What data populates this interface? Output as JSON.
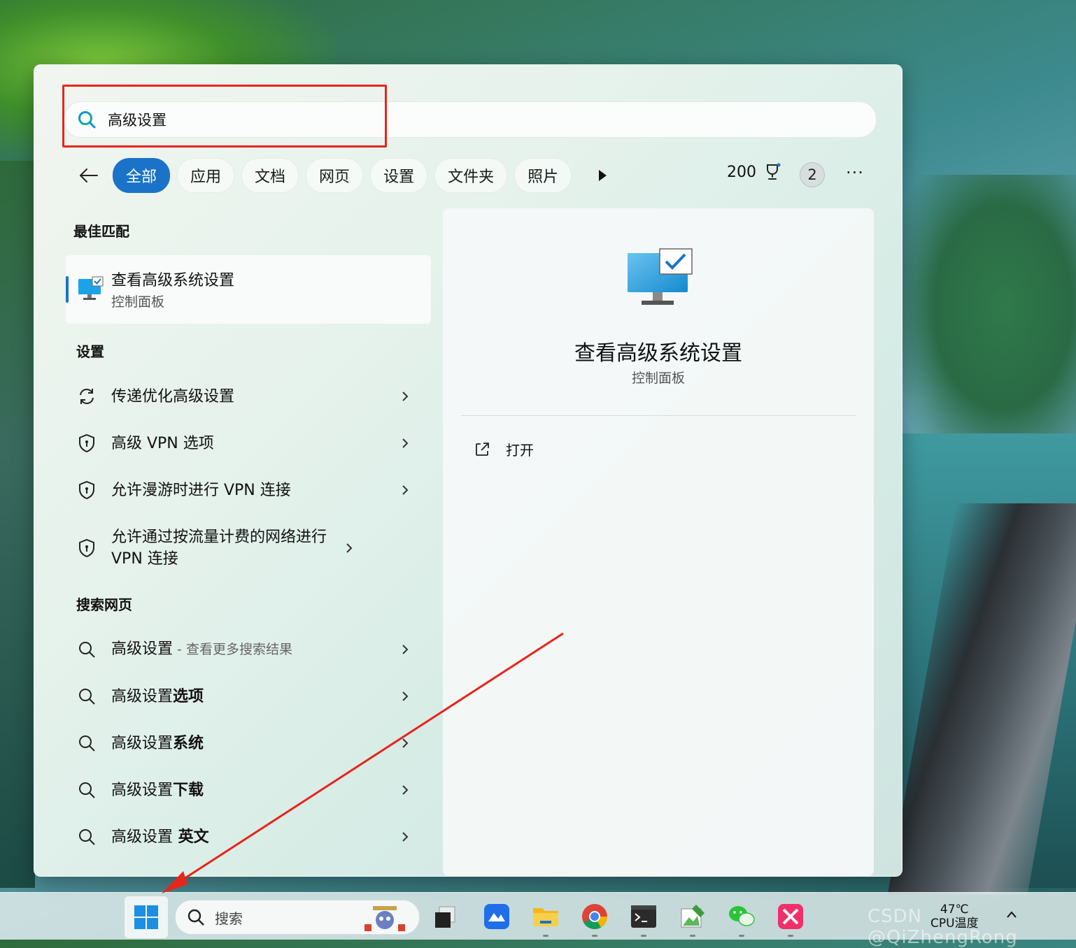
{
  "search": {
    "query": "高级设置"
  },
  "filters": {
    "chips": [
      "全部",
      "应用",
      "文档",
      "网页",
      "设置",
      "文件夹",
      "照片"
    ],
    "active_index": 0,
    "points": "200",
    "badge": "2",
    "more": "···"
  },
  "best_match": {
    "section": "最佳匹配",
    "title": "查看高级系统设置",
    "subtitle": "控制面板",
    "icon": "monitor-check-icon"
  },
  "settings": {
    "section": "设置",
    "items": [
      {
        "label": "传递优化高级设置",
        "icon": "sync-icon"
      },
      {
        "label": "高级 VPN 选项",
        "icon": "shield-icon"
      },
      {
        "label": "允许漫游时进行 VPN 连接",
        "icon": "shield-icon"
      },
      {
        "label": "允许通过按流量计费的网络进行 VPN 连接",
        "icon": "shield-icon"
      }
    ]
  },
  "web": {
    "section": "搜索网页",
    "items": [
      {
        "prefix": "高级设置",
        "suffix": " - 查看更多搜索结果",
        "bold": ""
      },
      {
        "prefix": "高级设置",
        "suffix": "",
        "bold": "选项"
      },
      {
        "prefix": "高级设置",
        "suffix": "",
        "bold": "系统"
      },
      {
        "prefix": "高级设置",
        "suffix": "",
        "bold": "下载"
      },
      {
        "prefix": "高级设置",
        "suffix": "",
        "bold": " 英文"
      }
    ]
  },
  "detail": {
    "title": "查看高级系统设置",
    "subtitle": "控制面板",
    "open_label": "打开"
  },
  "taskbar": {
    "search_label": "搜索",
    "temp": "47℃",
    "temp_label": "CPU温度"
  },
  "watermark": "CSDN @QiZhengRong",
  "colors": {
    "accent": "#1a73c8",
    "annotation": "#e8251b"
  }
}
